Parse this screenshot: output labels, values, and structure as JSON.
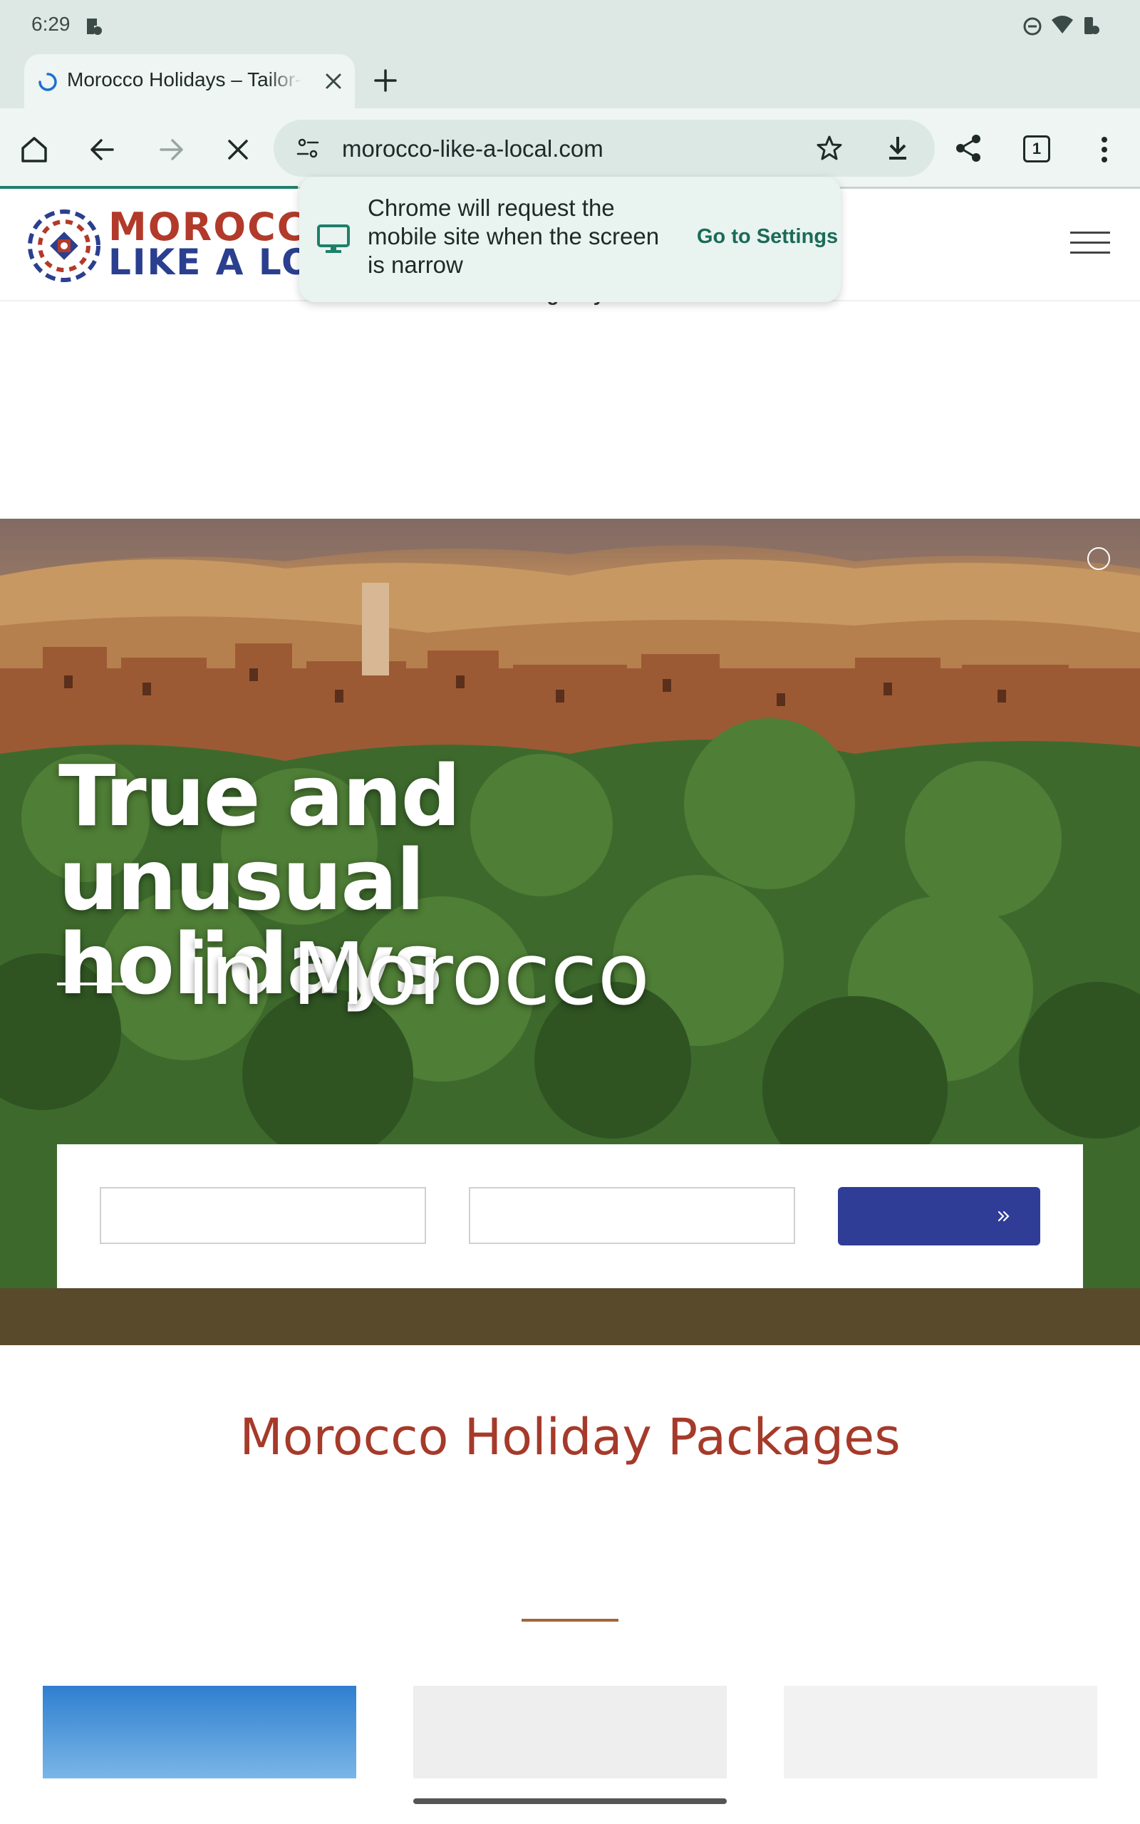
{
  "status_bar": {
    "time": "6:29"
  },
  "browser": {
    "tab": {
      "title": "Morocco Holidays – Tailor-made",
      "close_icon": "close-icon"
    },
    "new_tab_icon": "plus-icon",
    "url": "morocco-like-a-local.com",
    "tab_count": "1",
    "accent_color": "#1e7f6b"
  },
  "info_bubble": {
    "message": "Chrome will request the mobile site when the screen is narrow",
    "action": "Go to Settings"
  },
  "site": {
    "logo_line1": "MOROCCO",
    "logo_line2": "LIKE A LOC",
    "tagline": "Your Travel Agency in Morocco",
    "brand_red": "#b23a2a",
    "brand_blue": "#2b3f8f"
  },
  "hero": {
    "title_line1": "True and unusual",
    "title_line2": "holidays",
    "subtitle": "in Morocco"
  },
  "search": {
    "button_color": "#2f3d97",
    "button_icon": "double-chevron-right-icon"
  },
  "packages": {
    "title": "Morocco Holiday Packages",
    "title_color": "#a63a2a"
  }
}
